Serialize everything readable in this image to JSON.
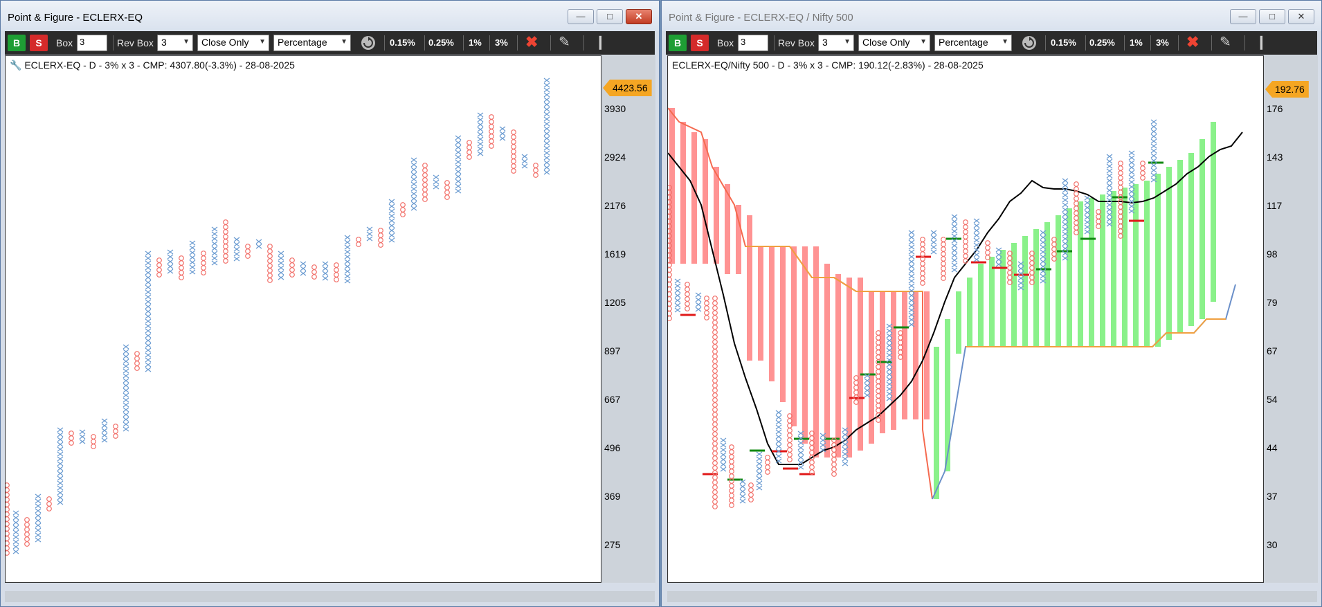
{
  "left": {
    "title": "Point & Figure - ECLERX-EQ",
    "info": "ECLERX-EQ - D - 3% x 3 - CMP: 4307.80(-3.3%) - 28-08-2025",
    "cmp_label": "4423.56",
    "price_ticks": [
      "3930",
      "2924",
      "2176",
      "1619",
      "1205",
      "897",
      "667",
      "496",
      "369",
      "275"
    ]
  },
  "right": {
    "title": "Point & Figure - ECLERX-EQ / Nifty 500",
    "info": "ECLERX-EQ/Nifty 500 - D - 3% x 3 - CMP: 190.12(-2.83%) - 28-08-2025",
    "cmp_label": "192.76",
    "price_ticks": [
      "176",
      "143",
      "117",
      "98",
      "79",
      "67",
      "54",
      "44",
      "37",
      "30"
    ]
  },
  "toolbar": {
    "buy": "B",
    "sell": "S",
    "box_label": "Box",
    "box_value": "3",
    "rev_label": "Rev Box",
    "rev_value": "3",
    "price_mode": "Close Only",
    "scale_mode": "Percentage",
    "presets": [
      "0.15%",
      "0.25%",
      "1%",
      "3%"
    ]
  },
  "icons": {
    "reset": "refresh-icon",
    "clear": "close-x-icon",
    "draw": "pencil-icon",
    "pin": "pin-icon",
    "settings": "wrench-icon"
  },
  "colors": {
    "x_col": "#6a9bd1",
    "o_col": "#f2706a",
    "bear_cloud": "#ff8080",
    "bull_cloud": "#7df07d",
    "cmp_tag": "#f5a623",
    "buy_btn": "#1e9e34",
    "sell_btn": "#d42a2a"
  }
}
